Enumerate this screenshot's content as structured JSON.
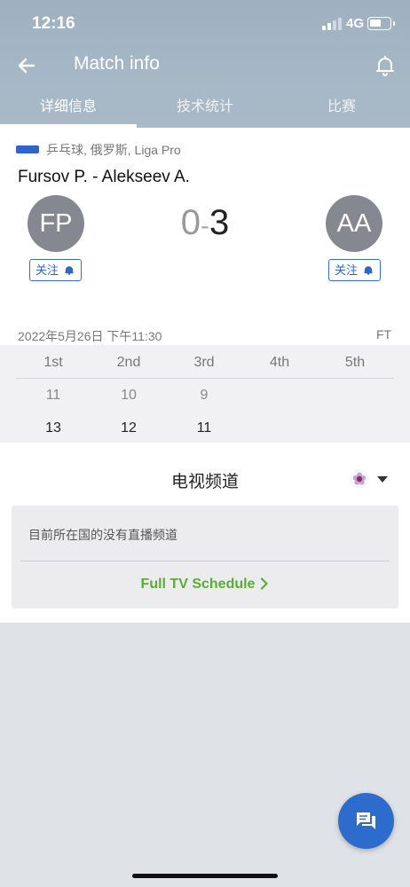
{
  "status_bar": {
    "time": "12:16",
    "network": "4G"
  },
  "header": {
    "title": "Match info"
  },
  "tabs": [
    {
      "label": "详细信息",
      "active": true
    },
    {
      "label": "技术统计",
      "active": false
    },
    {
      "label": "比赛",
      "active": false
    }
  ],
  "match": {
    "league": "乒乓球, 俄罗斯, Liga Pro",
    "title": "Fursov P. - Alekseev A.",
    "home": {
      "initials": "FP",
      "score": "0",
      "follow_label": "关注"
    },
    "away": {
      "initials": "AA",
      "score": "3",
      "follow_label": "关注"
    },
    "score_separator": "-",
    "datetime": "2022年5月26日 下午11:30",
    "status": "FT"
  },
  "periods": {
    "headers": [
      "1st",
      "2nd",
      "3rd",
      "4th",
      "5th"
    ],
    "home": [
      "11",
      "10",
      "9",
      "",
      ""
    ],
    "away": [
      "13",
      "12",
      "11",
      "",
      ""
    ]
  },
  "tv": {
    "title": "电视频道",
    "message": "目前所在国的没有直播频道",
    "link_label": "Full TV Schedule"
  },
  "colors": {
    "accent": "#2d6ccc",
    "link_green": "#5aac34",
    "header": "#a4b5c4"
  }
}
